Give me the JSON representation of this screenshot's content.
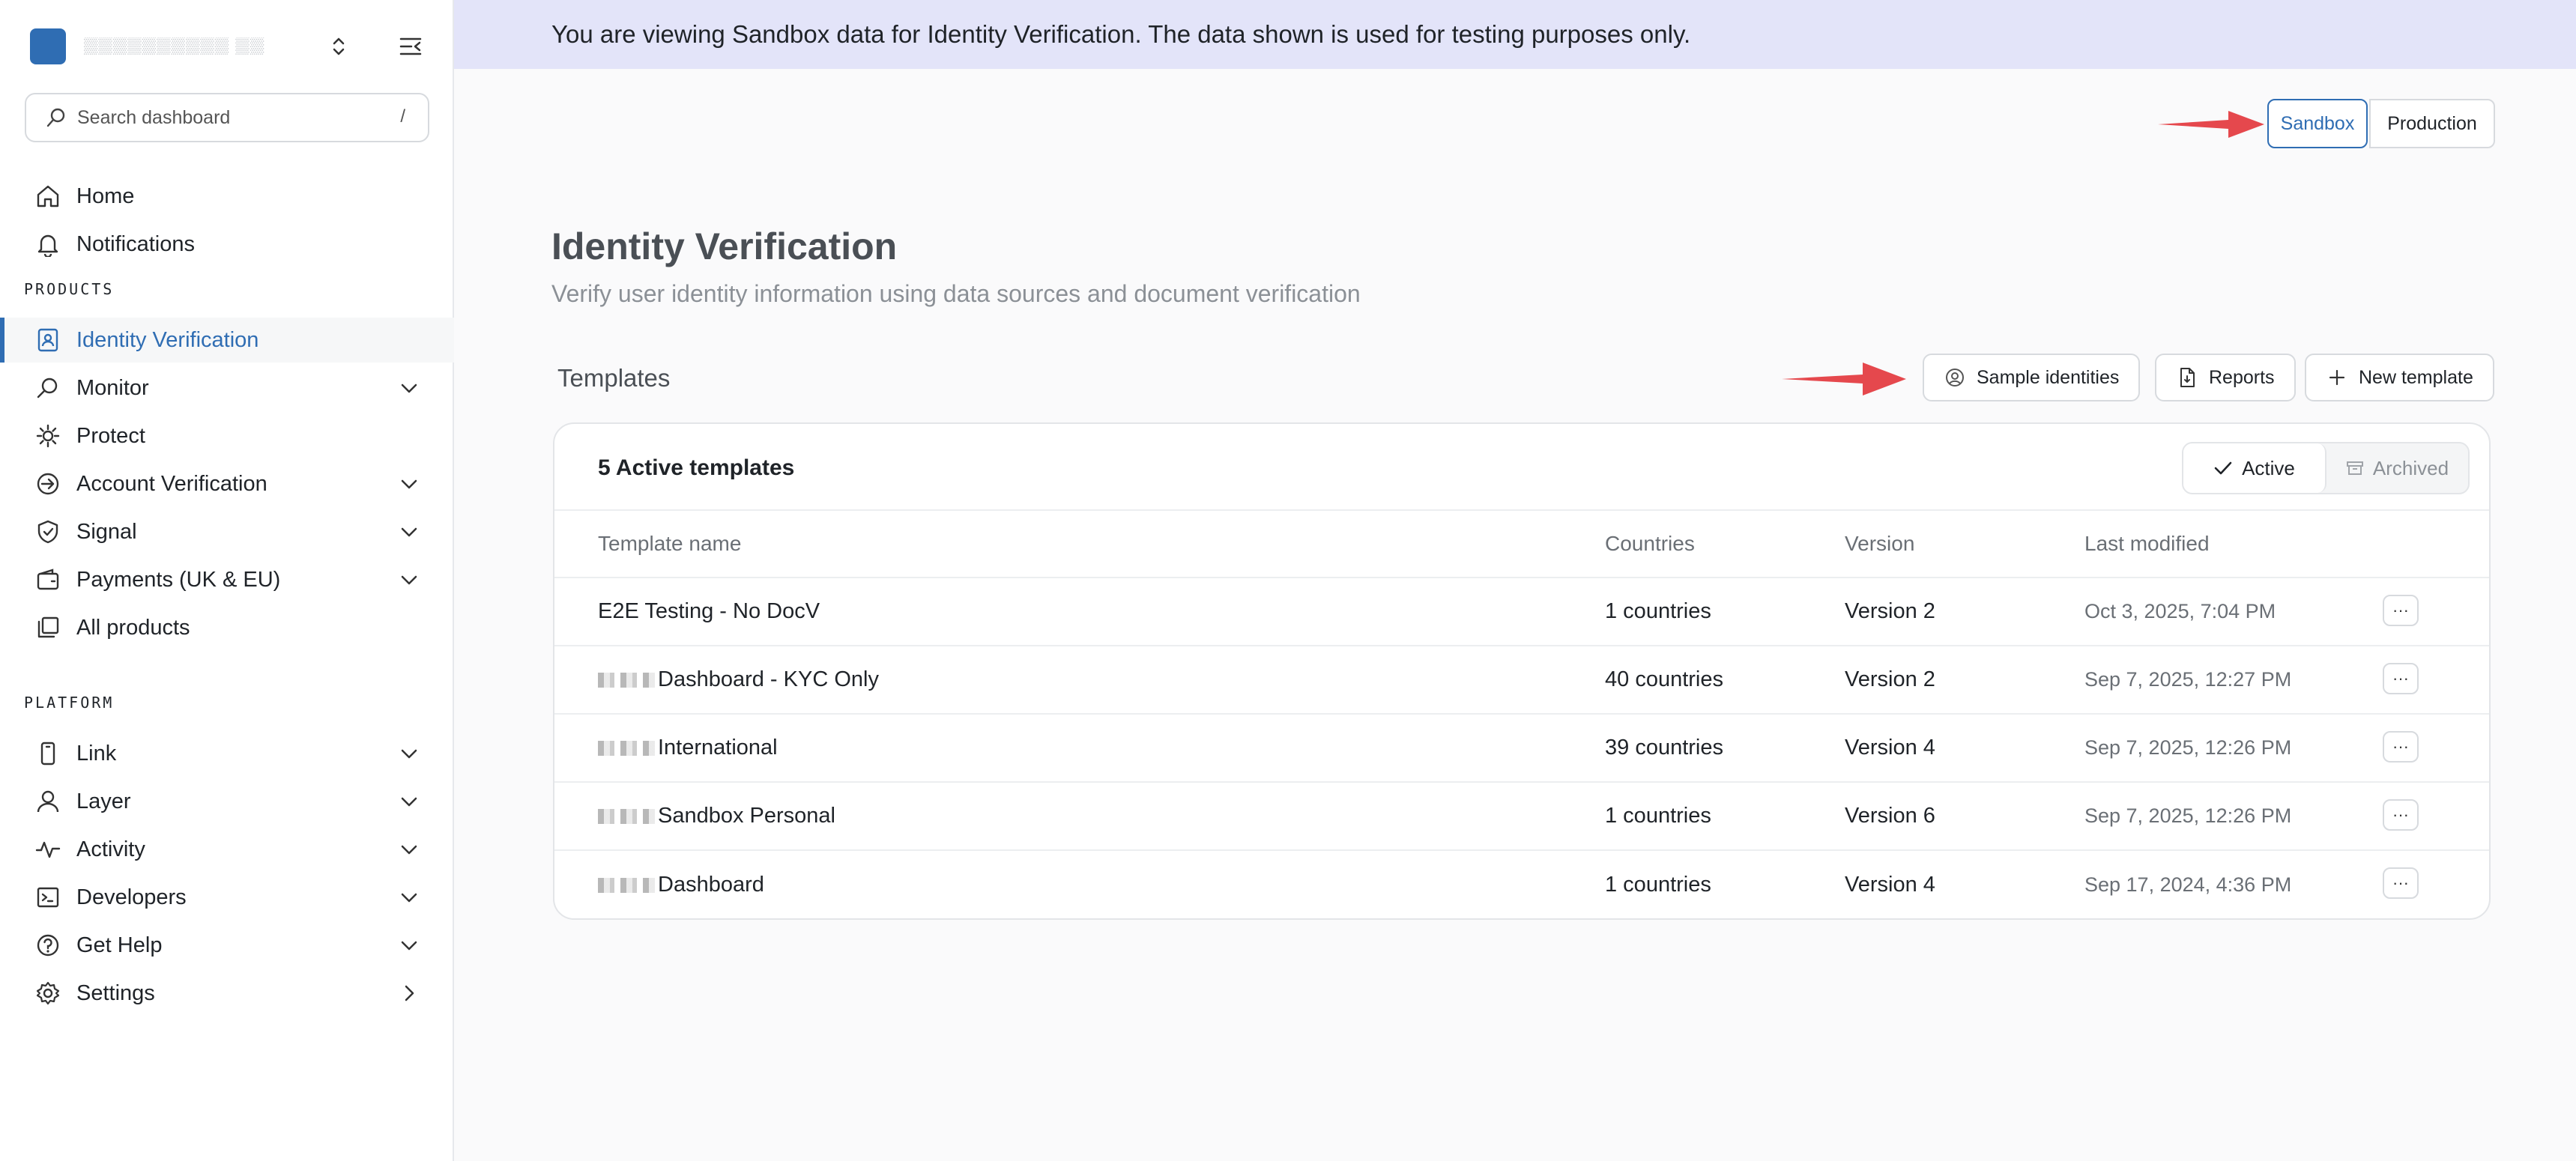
{
  "sidebar": {
    "workspace_name": "▒▒▒▒▒▒▒▒▒▒ ▒▒",
    "search_placeholder": "Search dashboard",
    "search_shortcut": "/",
    "nav_top": [
      {
        "label": "Home",
        "icon": "home-icon"
      },
      {
        "label": "Notifications",
        "icon": "bell-icon"
      }
    ],
    "products_heading": "PRODUCTS",
    "products": [
      {
        "label": "Identity Verification",
        "icon": "id-badge-icon",
        "active": true
      },
      {
        "label": "Monitor",
        "icon": "search-icon",
        "expandable": true
      },
      {
        "label": "Protect",
        "icon": "gear-shield-icon"
      },
      {
        "label": "Account Verification",
        "icon": "arrow-circle-icon",
        "expandable": true
      },
      {
        "label": "Signal",
        "icon": "shield-check-icon",
        "expandable": true
      },
      {
        "label": "Payments (UK & EU)",
        "icon": "wallet-icon",
        "expandable": true
      },
      {
        "label": "All products",
        "icon": "stack-icon"
      }
    ],
    "platform_heading": "PLATFORM",
    "platform": [
      {
        "label": "Link",
        "icon": "phone-icon",
        "expandable": true
      },
      {
        "label": "Layer",
        "icon": "user-icon",
        "expandable": true
      },
      {
        "label": "Activity",
        "icon": "pulse-icon",
        "expandable": true
      },
      {
        "label": "Developers",
        "icon": "terminal-icon",
        "expandable": true
      },
      {
        "label": "Get Help",
        "icon": "help-icon",
        "expandable": true
      },
      {
        "label": "Settings",
        "icon": "settings-icon",
        "chevron": "right"
      }
    ]
  },
  "banner": {
    "text": "You are viewing Sandbox data for Identity Verification. The data shown is used for testing purposes only."
  },
  "environment": {
    "sandbox_label": "Sandbox",
    "production_label": "Production",
    "selected": "Sandbox"
  },
  "page": {
    "title": "Identity Verification",
    "subtitle": "Verify user identity information using data sources and document verification"
  },
  "templates_section": {
    "heading": "Templates",
    "sample_identities_label": "Sample identities",
    "reports_label": "Reports",
    "new_template_label": "New template"
  },
  "card": {
    "title": "5 Active templates",
    "filter_active": "Active",
    "filter_archived": "Archived",
    "columns": [
      "Template name",
      "Countries",
      "Version",
      "Last modified"
    ],
    "rows": [
      {
        "name": "E2E Testing - No DocV",
        "redacted_prefix": false,
        "countries": "1 countries",
        "version": "Version 2",
        "modified": "Oct 3, 2025, 7:04 PM"
      },
      {
        "name": "Dashboard - KYC Only",
        "redacted_prefix": true,
        "countries": "40 countries",
        "version": "Version 2",
        "modified": "Sep 7, 2025, 12:27 PM"
      },
      {
        "name": "International",
        "redacted_prefix": true,
        "countries": "39 countries",
        "version": "Version 4",
        "modified": "Sep 7, 2025, 12:26 PM"
      },
      {
        "name": "Sandbox Personal",
        "redacted_prefix": true,
        "countries": "1 countries",
        "version": "Version 6",
        "modified": "Sep 7, 2025, 12:26 PM"
      },
      {
        "name": "Dashboard",
        "redacted_prefix": true,
        "countries": "1 countries",
        "version": "Version 4",
        "modified": "Sep 17, 2024, 4:36 PM"
      }
    ],
    "row_menu_label": "···"
  },
  "colors": {
    "accent": "#2f6db3",
    "banner_bg": "#e3e4f9",
    "arrow": "#e5484d"
  }
}
